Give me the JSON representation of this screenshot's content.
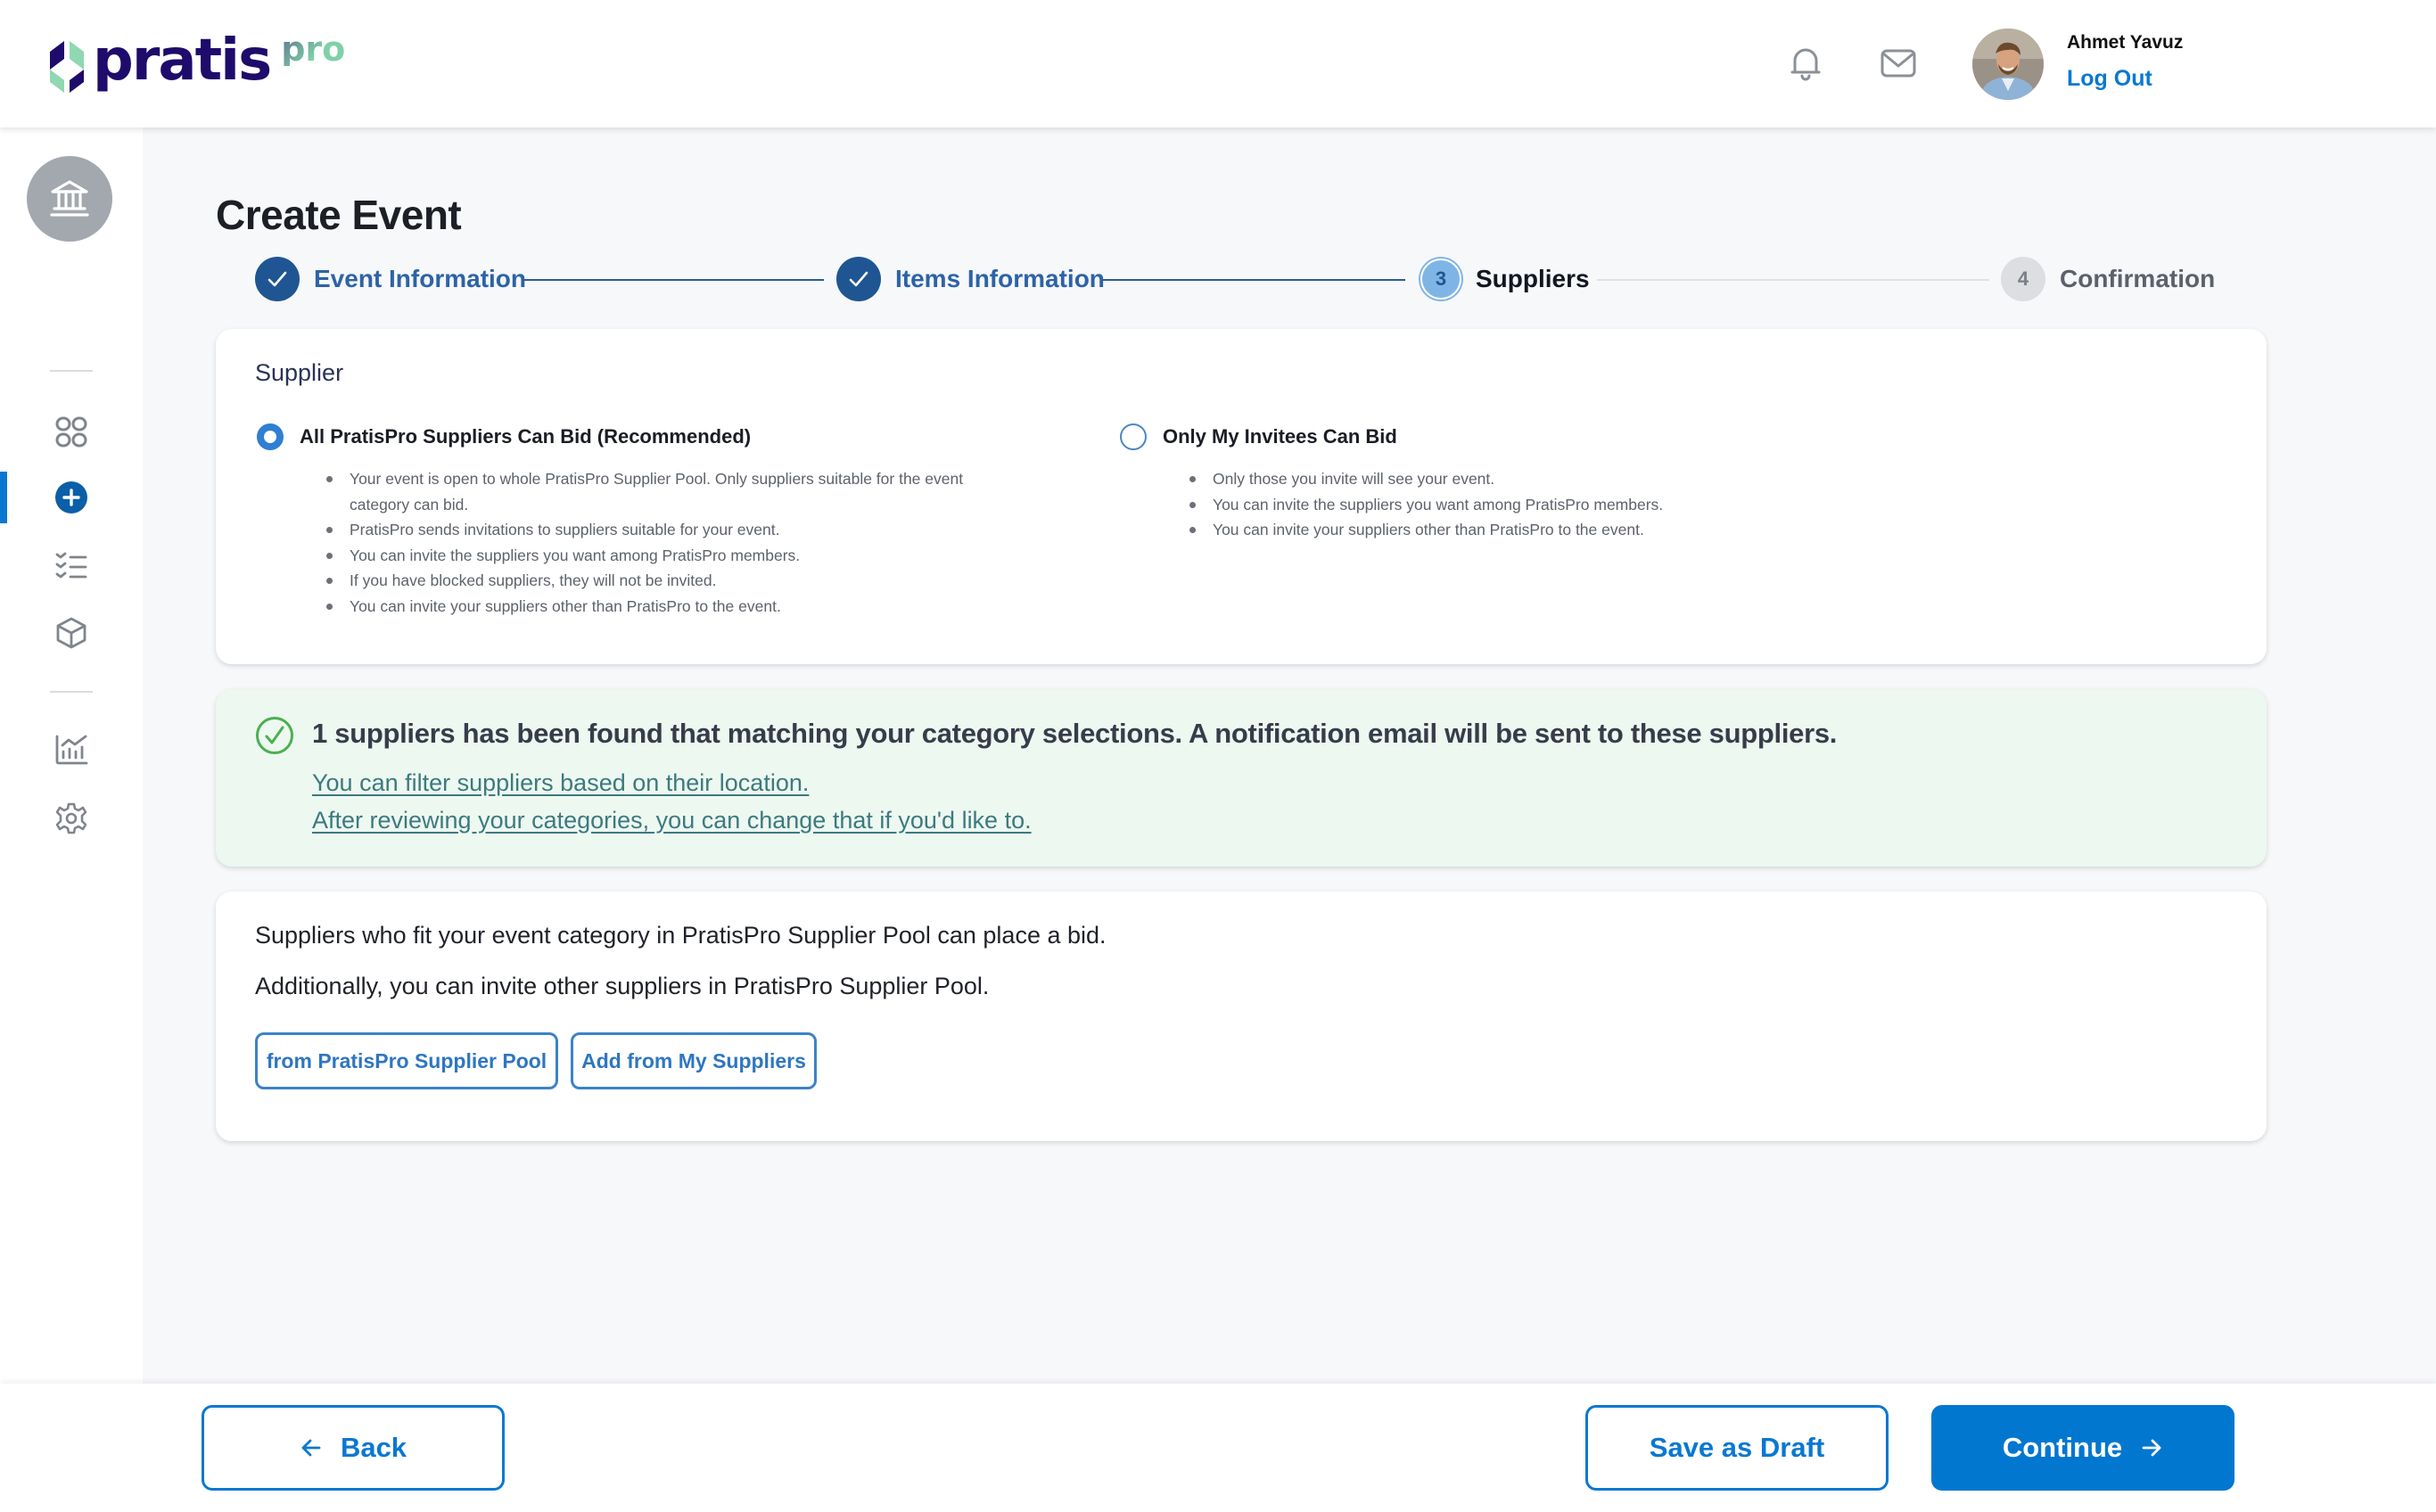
{
  "header": {
    "brand": {
      "name": "pratis",
      "suffix": "pro"
    },
    "icons": {
      "notifications": "bell-icon",
      "messages": "mail-icon"
    },
    "user": {
      "name": "Ahmet Yavuz",
      "logout_label": "Log Out"
    }
  },
  "sidebar": {
    "org_icon": "bank-building-icon",
    "items": [
      {
        "id": "dashboard",
        "icon": "grid-icon",
        "active": false
      },
      {
        "id": "create-event",
        "icon": "plus-circle-icon",
        "active": true
      },
      {
        "id": "events",
        "icon": "checklist-icon",
        "active": false
      },
      {
        "id": "products",
        "icon": "cube-icon",
        "active": false
      },
      {
        "id": "reports",
        "icon": "chart-icon",
        "active": false
      },
      {
        "id": "settings",
        "icon": "gear-icon",
        "active": false
      }
    ]
  },
  "page": {
    "title": "Create Event",
    "steps": [
      {
        "number": "1",
        "label": "Event Information",
        "state": "done"
      },
      {
        "number": "2",
        "label": "Items Information",
        "state": "done"
      },
      {
        "number": "3",
        "label": "Suppliers",
        "state": "current"
      },
      {
        "number": "4",
        "label": "Confirmation",
        "state": "todo"
      }
    ]
  },
  "supplier_card": {
    "heading": "Supplier",
    "options": [
      {
        "label": "All PratisPro Suppliers Can Bid (Recommended)",
        "selected": true,
        "bullets": [
          "Your event is open to whole PratisPro Supplier Pool. Only suppliers suitable for the event category can bid.",
          "PratisPro sends invitations to suppliers suitable for your event.",
          "You can invite the suppliers you want among PratisPro members.",
          "If you have blocked suppliers, they will not be invited.",
          "You can invite your suppliers other than PratisPro to the event."
        ]
      },
      {
        "label": "Only My Invitees Can Bid",
        "selected": false,
        "bullets": [
          "Only those you invite will see your event.",
          "You can invite the suppliers you want among PratisPro members.",
          "You can invite your suppliers other than PratisPro to the event."
        ]
      }
    ]
  },
  "notice": {
    "icon": "check-circle-icon",
    "message": "1 suppliers has been found that matching your category selections. A notification email will be sent to these suppliers.",
    "links": [
      "You can filter suppliers based on their location.",
      "After reviewing your categories, you can change that if you'd like to."
    ]
  },
  "invite_card": {
    "line1": "Suppliers who fit your event category in PratisPro Supplier Pool can place a bid.",
    "line2": "Additionally, you can invite other suppliers in PratisPro Supplier Pool.",
    "buttons": [
      "from PratisPro Supplier Pool",
      "Add from My Suppliers"
    ]
  },
  "footer": {
    "back_label": "Back",
    "draft_label": "Save as Draft",
    "continue_label": "Continue"
  },
  "colors": {
    "primary": "#0277D0",
    "step_done": "#1F5592",
    "step_current": "#7FB5E6",
    "success_bg": "#EDF8F1",
    "success_icon": "#4CAF50",
    "brand_dark": "#1E0B6B",
    "brand_green": "#7FD1A8"
  }
}
